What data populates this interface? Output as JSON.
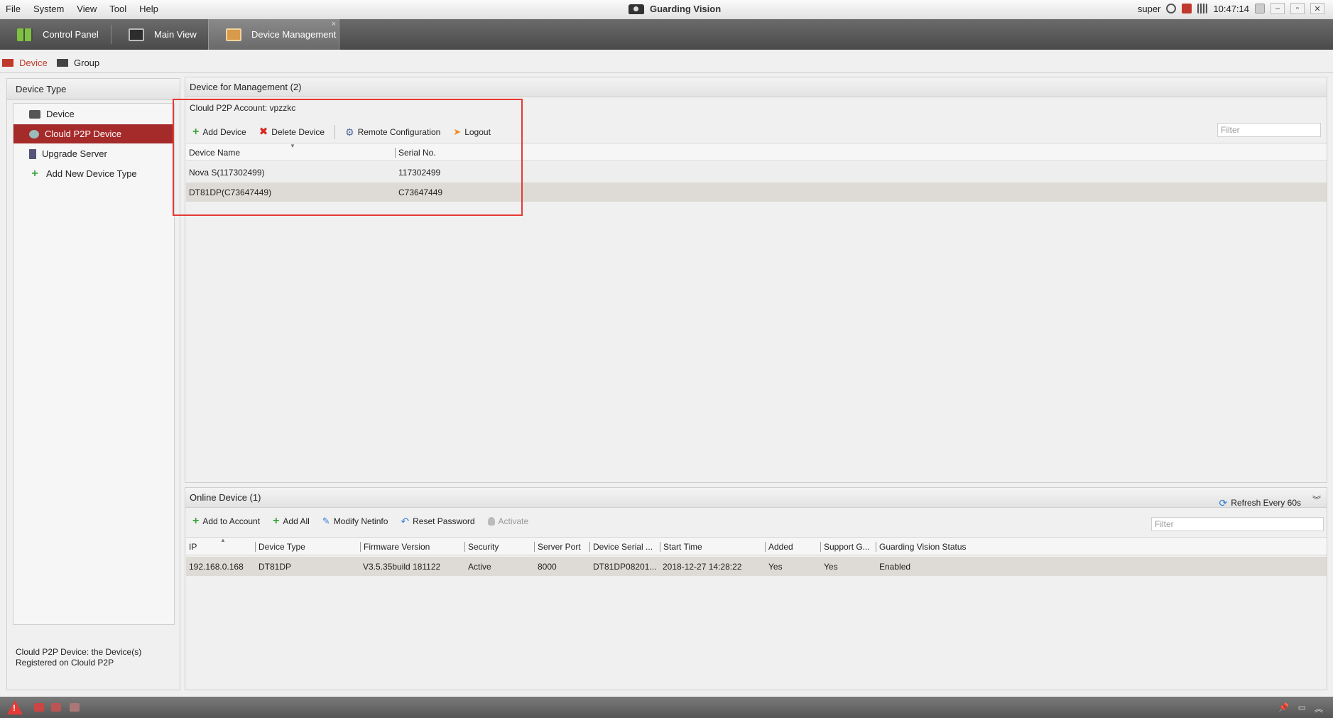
{
  "menu": [
    "File",
    "System",
    "View",
    "Tool",
    "Help"
  ],
  "app_title": "Guarding Vision",
  "status": {
    "user": "super",
    "time": "10:47:14"
  },
  "window_controls": {
    "minimize": "–",
    "restore": "▫",
    "close": "✕"
  },
  "modules": [
    {
      "label": "Control Panel"
    },
    {
      "label": "Main View"
    },
    {
      "label": "Device Management",
      "close": "×"
    }
  ],
  "subtabs": [
    {
      "label": "Device"
    },
    {
      "label": "Group"
    }
  ],
  "left": {
    "header": "Device Type",
    "items": [
      {
        "label": "Device"
      },
      {
        "label": "Clould P2P Device"
      },
      {
        "label": "Upgrade Server"
      },
      {
        "label": "Add New Device Type"
      }
    ],
    "description": "Clould P2P Device: the Device(s) Registered on Clould P2P"
  },
  "management": {
    "header": "Device for Management (2)",
    "account_label": "Clould P2P Account:",
    "account_value": "vpzzkc",
    "toolbar": {
      "add": "Add Device",
      "delete": "Delete Device",
      "remote": "Remote Configuration",
      "logout": "Logout"
    },
    "filter_placeholder": "Filter",
    "columns": [
      "Device Name",
      "Serial No."
    ],
    "rows": [
      {
        "name": "Nova S(117302499)",
        "serial": "117302499"
      },
      {
        "name": "DT81DP(C73647449)",
        "serial": "C73647449"
      }
    ]
  },
  "online": {
    "header": "Online Device (1)",
    "refresh": "Refresh Every 60s",
    "toolbar": {
      "add_account": "Add to Account",
      "add_all": "Add All",
      "modify": "Modify Netinfo",
      "reset": "Reset Password",
      "activate": "Activate"
    },
    "filter_placeholder": "Filter",
    "columns": [
      "IP",
      "Device Type",
      "Firmware Version",
      "Security",
      "Server Port",
      "Device Serial ...",
      "Start Time",
      "Added",
      "Support G...",
      "Guarding Vision Status"
    ],
    "rows": [
      {
        "ip": "192.168.0.168",
        "type": "DT81DP",
        "firmware": "V3.5.35build 181122",
        "security": "Active",
        "port": "8000",
        "serial": "DT81DP08201...",
        "start": "2018-12-27 14:28:22",
        "added": "Yes",
        "support": "Yes",
        "status": "Enabled"
      }
    ]
  }
}
